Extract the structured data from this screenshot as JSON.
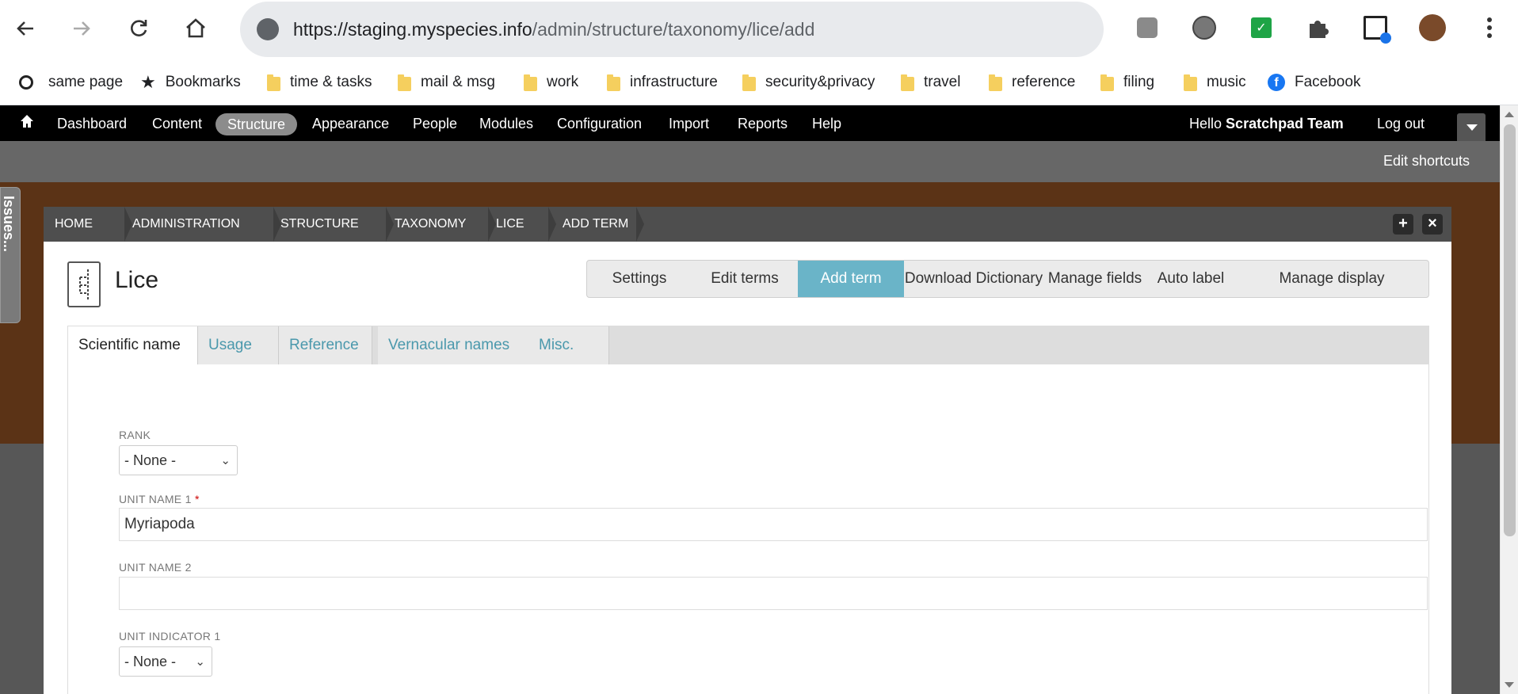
{
  "browser": {
    "url_host": "https://staging.myspecies.info",
    "url_path": "/admin/structure/taxonomy/lice/add",
    "bookmarks": [
      {
        "label": "same page"
      },
      {
        "label": "Bookmarks"
      },
      {
        "label": "time & tasks"
      },
      {
        "label": "mail & msg"
      },
      {
        "label": "work"
      },
      {
        "label": "infrastructure"
      },
      {
        "label": "security&privacy"
      },
      {
        "label": "travel"
      },
      {
        "label": "reference"
      },
      {
        "label": "filing"
      },
      {
        "label": "music"
      },
      {
        "label": "Facebook"
      }
    ]
  },
  "admin_menu": {
    "items": [
      "Dashboard",
      "Content",
      "Structure",
      "Appearance",
      "People",
      "Modules",
      "Configuration",
      "Import",
      "Reports",
      "Help"
    ],
    "active": "Structure",
    "hello_prefix": "Hello",
    "user": "Scratchpad Team",
    "logout": "Log out",
    "edit_shortcuts": "Edit shortcuts"
  },
  "side_tab": "Issues...",
  "breadcrumb": [
    "HOME",
    "ADMINISTRATION",
    "STRUCTURE",
    "TAXONOMY",
    "LICE",
    "ADD TERM"
  ],
  "overlay_buttons": {
    "add": "+",
    "close": "×"
  },
  "page_title": "Lice",
  "action_tabs": [
    "Settings",
    "Edit terms",
    "Add term",
    "Download Dictionary",
    "Manage fields",
    "Auto label",
    "Manage display"
  ],
  "action_tab_active": "Add term",
  "vertical_tabs": [
    "Scientific name",
    "Usage",
    "Reference",
    "Vernacular names",
    "Misc."
  ],
  "vertical_tab_active": "Scientific name",
  "form": {
    "rank_label": "RANK",
    "rank_value": "- None -",
    "unit_name_1_label": "UNIT NAME 1",
    "required_mark": "*",
    "unit_name_1_value": "Myriapoda",
    "unit_name_2_label": "UNIT NAME 2",
    "unit_name_2_value": "",
    "unit_indicator_1_label": "UNIT INDICATOR 1",
    "unit_indicator_1_value": "- None -"
  }
}
